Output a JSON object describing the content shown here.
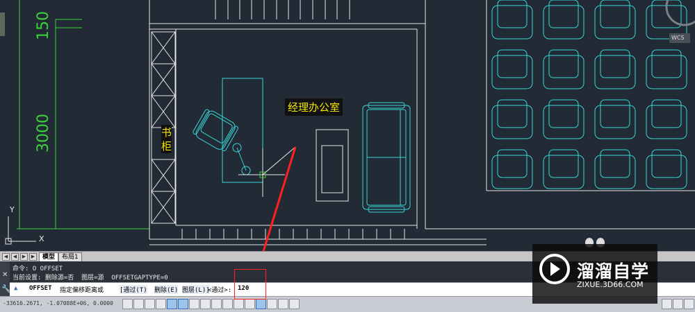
{
  "drawing": {
    "dim_150": "150",
    "dim_3000": "3000",
    "room_label": "经理办公室",
    "bookcase_label_1": "书",
    "bookcase_label_2": "柜",
    "ucs_y": "Y",
    "ucs_x": "X",
    "viewcube_wcs": "WCS"
  },
  "tabs": {
    "model": "模型",
    "layout1": "布局1"
  },
  "command": {
    "history_line1": "命令: O OFFSET",
    "history_line2": "当前设置: 删除源=否  图层=源  OFFSETGAPTYPE=0",
    "prompt_command": "OFFSET",
    "prompt_text": "指定偏移距离或",
    "option_through": "[通过(T)",
    "option_erase": "删除(E)",
    "option_layer": "图层(L)]",
    "default_value": "<通过>:",
    "input_value": "120"
  },
  "status": {
    "coords": "-33616.2671, -1.07088E+06, 0.0000"
  },
  "watermark": {
    "title": "溜溜自学",
    "url": "ZIXUE.3D66.COM"
  },
  "colors": {
    "canvas_bg": "#222a35",
    "dim_green": "#3bd13b",
    "cyan": "#35d8d8",
    "label_yellow": "#f2e400",
    "arrow_red": "#ff2020"
  }
}
